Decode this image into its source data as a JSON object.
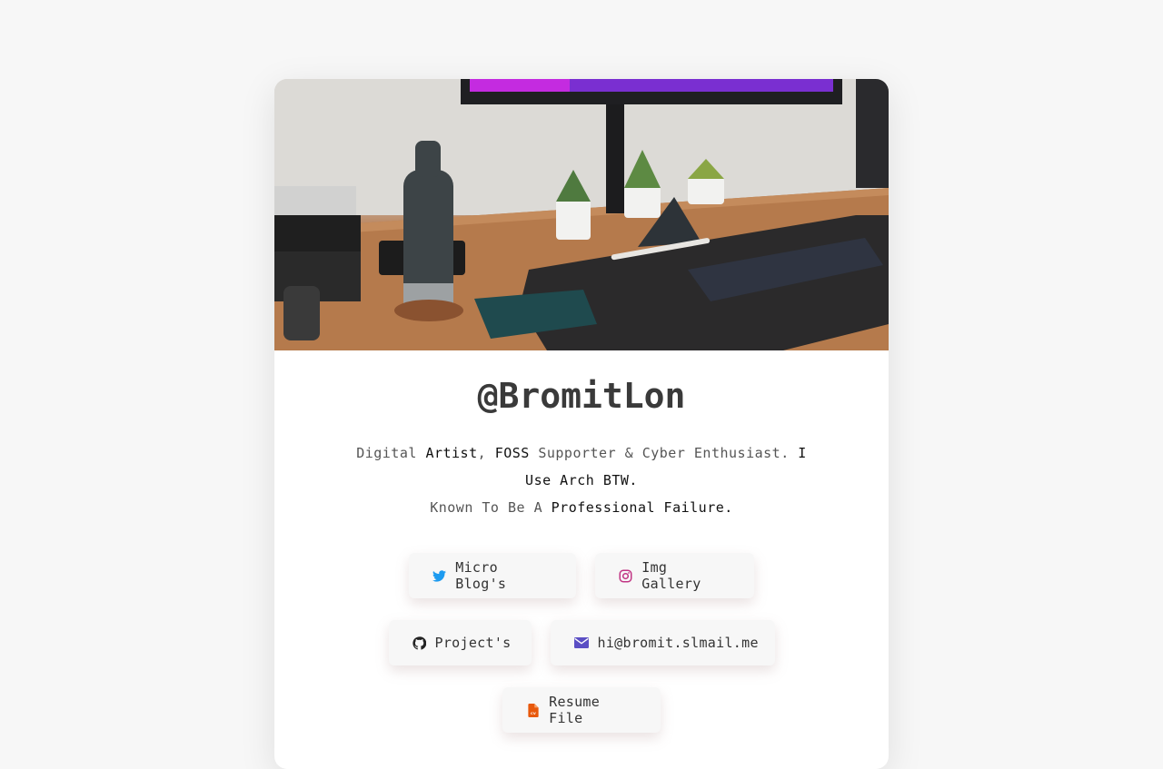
{
  "profile": {
    "handle": "@BromitLon",
    "bio": {
      "p1": "Digital ",
      "b1": "Artist",
      "p2": ", ",
      "b2": "FOSS",
      "p3": " Supporter & Cyber Enthusiast. ",
      "b3": "I Use Arch BTW.",
      "p4": "Known To Be A ",
      "b4": "Professional Failure."
    }
  },
  "buttons": {
    "micro_blog": "Micro Blog's",
    "img_gallery": "Img Gallery",
    "projects": "Project's",
    "email": "hi@bromit.slmail.me",
    "resume": "Resume File"
  },
  "icons": {
    "micro_blog": "twitter-icon",
    "img_gallery": "instagram-icon",
    "projects": "github-icon",
    "email": "envelope-icon",
    "resume": "file-cv-icon"
  },
  "colors": {
    "twitter": "#1d9bf0",
    "instagram": "#c13584",
    "github": "#222222",
    "email": "#5b4fc4",
    "resume": "#e8590c",
    "page_bg": "#f7f7f7",
    "card_bg": "#ffffff"
  }
}
